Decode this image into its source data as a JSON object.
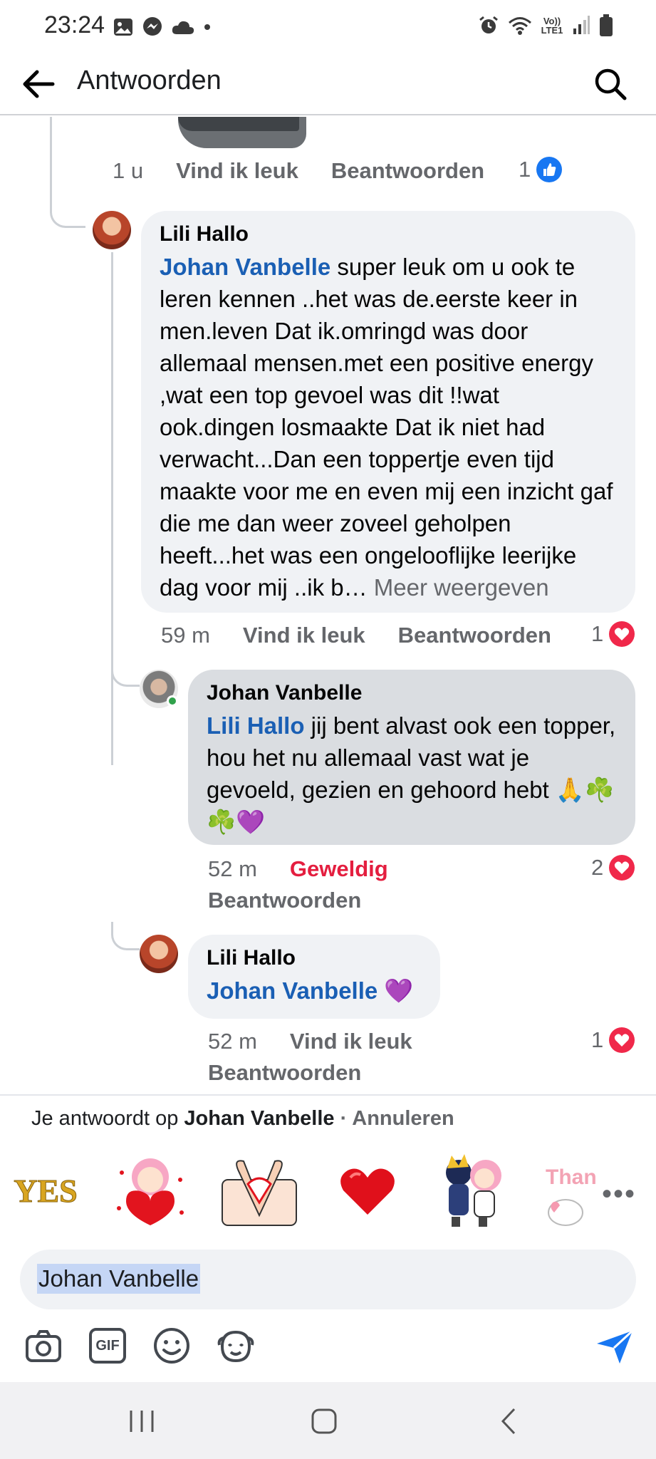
{
  "status_bar": {
    "time": "23:24",
    "left_icons": [
      "gallery-icon",
      "messenger-icon",
      "cloud-icon",
      "dot-icon"
    ],
    "right_icons": [
      "alarm-icon",
      "wifi-icon",
      "volte-icon",
      "signal-icon",
      "battery-icon"
    ],
    "volte_label": "Vo)) LTE1"
  },
  "app_bar": {
    "title": "Antwoorden",
    "back_icon": "arrow-left-icon",
    "search_icon": "search-icon"
  },
  "previous_comment": {
    "time": "1 u",
    "like_label": "Vind ik leuk",
    "reply_label": "Beantwoorden",
    "reaction_count": "1",
    "reaction_type": "like",
    "reaction_color": "#1877f2"
  },
  "comments": [
    {
      "author": "Lili Hallo",
      "mention": "Johan Vanbelle",
      "text": " super leuk om u ook te leren kennen ..het was de.eerste keer in men.leven Dat ik.omringd was door allemaal mensen.met een positive energy ,wat een top gevoel was dit !!wat ook.dingen losmaakte Dat ik niet had verwacht...Dan een toppertje even tijd maakte voor me en even mij een inzicht gaf die me dan weer zoveel geholpen heeft...het was een ongelooflijke leerijke dag voor mij ..ik b… ",
      "more": "Meer weergeven",
      "time": "59 m",
      "like_label": "Vind ik leuk",
      "reply_label": "Beantwoorden",
      "reaction_count": "1",
      "reaction_type": "love"
    },
    {
      "author": "Johan Vanbelle",
      "mention": "Lili Hallo",
      "text": " jij bent alvast ook een topper, hou het nu allemaal vast wat je gevoeld, gezien en gehoord hebt 🙏☘️☘️💜",
      "time": "52 m",
      "like_label": "Geweldig",
      "reply_label": "Beantwoorden",
      "reaction_count": "2",
      "reaction_type": "love",
      "like_label_color": "#e41e3f",
      "online": true
    },
    {
      "author": "Lili Hallo",
      "mention": "Johan Vanbelle",
      "text": " 💜",
      "time": "52 m",
      "like_label": "Vind ik leuk",
      "reply_label": "Beantwoorden",
      "reaction_count": "1",
      "reaction_type": "love"
    }
  ],
  "reply_bar": {
    "prefix": "Je antwoordt op ",
    "name": "Johan Vanbelle",
    "separator": " · ",
    "cancel": "Annuleren"
  },
  "stickers": {
    "items": [
      "yes-sticker",
      "heart-girl-sticker",
      "heart-hands-sticker",
      "red-heart-sticker",
      "couple-sticker",
      "thank-you-sticker"
    ],
    "yes_text": "YES",
    "thanks_text": "Than",
    "more": "•••"
  },
  "composer": {
    "value": "Johan Vanbelle"
  },
  "toolbar": {
    "icons": [
      "camera-icon",
      "gif-icon",
      "emoji-icon",
      "avatar-sticker-icon",
      "send-icon"
    ],
    "gif_label": "GIF"
  },
  "colors": {
    "mention": "#1a5fb4",
    "love": "#f0284a",
    "like": "#1877f2",
    "bubble": "#f0f2f5",
    "bubble_selected": "#dadde1"
  }
}
